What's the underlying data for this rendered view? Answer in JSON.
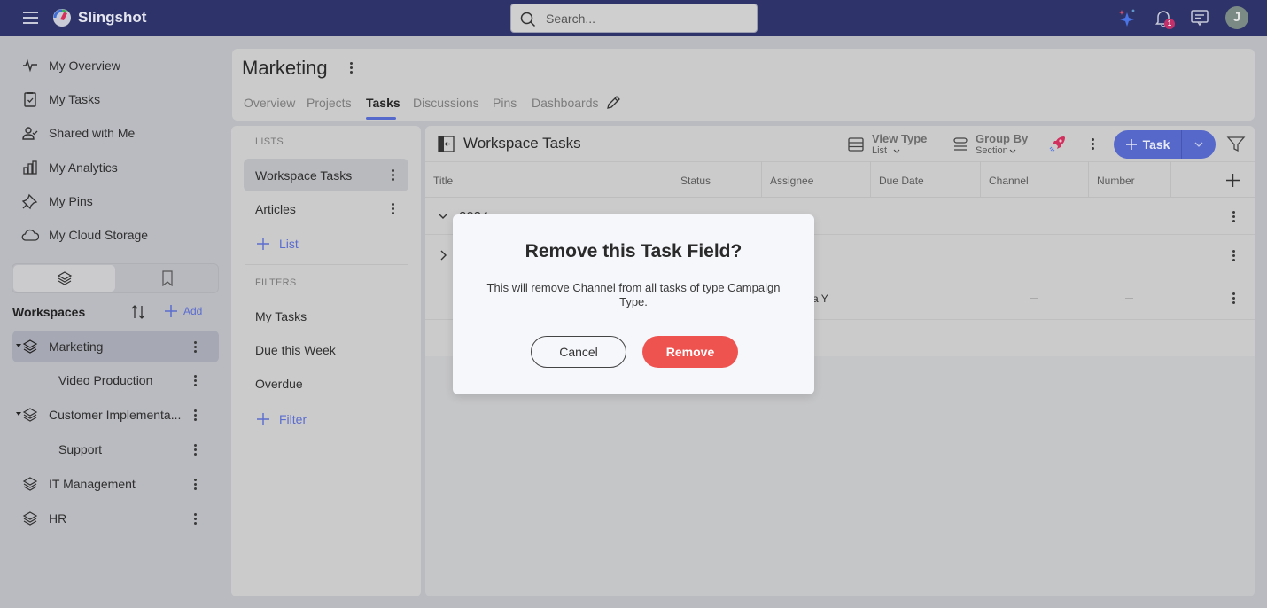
{
  "app": {
    "brand": "Slingshot",
    "search_placeholder": "Search...",
    "notifications_count": "1",
    "avatar_initial": "J"
  },
  "sidebar": {
    "nav": [
      {
        "label": "My Overview",
        "icon": "pulse-icon"
      },
      {
        "label": "My Tasks",
        "icon": "clipboard-check-icon"
      },
      {
        "label": "Shared with Me",
        "icon": "user-check-icon"
      },
      {
        "label": "My Analytics",
        "icon": "bar-chart-icon"
      },
      {
        "label": "My Pins",
        "icon": "pin-icon"
      },
      {
        "label": "My Cloud Storage",
        "icon": "cloud-icon"
      }
    ],
    "workspaces_title": "Workspaces",
    "add_label": "Add",
    "workspaces": [
      {
        "label": "Marketing",
        "expanded": true,
        "active": true
      },
      {
        "label": "Video Production",
        "child": true
      },
      {
        "label": "Customer Implementa...",
        "expanded": true
      },
      {
        "label": "Support",
        "child": true
      },
      {
        "label": "IT Management"
      },
      {
        "label": "HR"
      }
    ]
  },
  "workspace": {
    "name": "Marketing",
    "tabs": [
      "Overview",
      "Projects",
      "Tasks",
      "Discussions",
      "Pins",
      "Dashboards"
    ],
    "active_tab": "Tasks"
  },
  "lists_panel": {
    "lists_label": "LISTS",
    "lists": [
      "Workspace Tasks",
      "Articles"
    ],
    "add_list_label": "List",
    "filters_label": "FILTERS",
    "filters": [
      "My Tasks",
      "Due this Week",
      "Overdue"
    ],
    "add_filter_label": "Filter"
  },
  "tasks": {
    "title": "Workspace Tasks",
    "view_type_label": "View Type",
    "view_type_value": "List",
    "group_by_label": "Group By",
    "group_by_value": "Section",
    "add_task_label": "Task",
    "columns": [
      "Title",
      "Status",
      "Assignee",
      "Due Date",
      "Channel",
      "Number"
    ],
    "group_label": "2024",
    "row_assignee_partial": "a Y",
    "empty_value": "—"
  },
  "dialog": {
    "title": "Remove this Task Field?",
    "message": "This will remove Channel from all tasks of type Campaign Type.",
    "cancel_label": "Cancel",
    "remove_label": "Remove"
  },
  "colors": {
    "topbar": "#2e3469",
    "accent": "#5669cb",
    "danger": "#ef5350",
    "badge": "#c2316a"
  }
}
